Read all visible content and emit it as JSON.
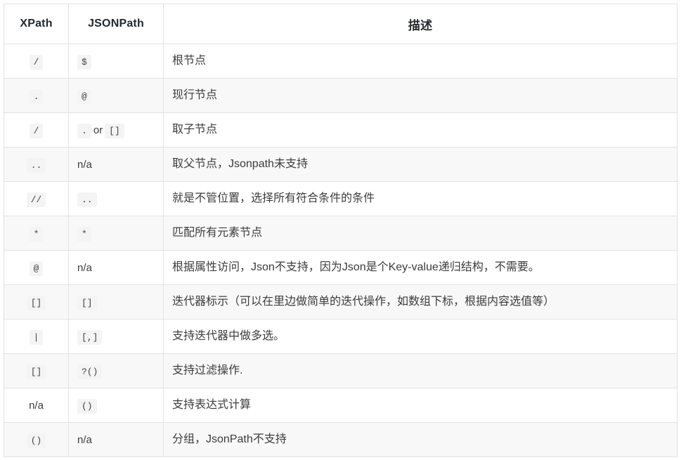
{
  "table": {
    "headers": {
      "xpath": "XPath",
      "jsonpath": "JSONPath",
      "description": "描述"
    },
    "rows": [
      {
        "xpath": [
          {
            "type": "code",
            "text": "/"
          }
        ],
        "jsonpath": [
          {
            "type": "code",
            "text": "$"
          }
        ],
        "description": "根节点"
      },
      {
        "xpath": [
          {
            "type": "code",
            "text": "."
          }
        ],
        "jsonpath": [
          {
            "type": "code",
            "text": "@"
          }
        ],
        "description": "现行节点"
      },
      {
        "xpath": [
          {
            "type": "code",
            "text": "/"
          }
        ],
        "jsonpath": [
          {
            "type": "code",
            "text": "."
          },
          {
            "type": "text",
            "text": "or"
          },
          {
            "type": "code",
            "text": "[]"
          }
        ],
        "description": "取子节点"
      },
      {
        "xpath": [
          {
            "type": "code",
            "text": ".."
          }
        ],
        "jsonpath": [
          {
            "type": "plain",
            "text": "n/a"
          }
        ],
        "description": "取父节点，Jsonpath未支持"
      },
      {
        "xpath": [
          {
            "type": "code",
            "text": "//"
          }
        ],
        "jsonpath": [
          {
            "type": "code",
            "text": ".."
          }
        ],
        "description": "就是不管位置，选择所有符合条件的条件"
      },
      {
        "xpath": [
          {
            "type": "code",
            "text": "*"
          }
        ],
        "jsonpath": [
          {
            "type": "code",
            "text": "*"
          }
        ],
        "description": "匹配所有元素节点"
      },
      {
        "xpath": [
          {
            "type": "code",
            "text": "@"
          }
        ],
        "jsonpath": [
          {
            "type": "plain",
            "text": "n/a"
          }
        ],
        "description": "根据属性访问，Json不支持，因为Json是个Key-value递归结构，不需要。"
      },
      {
        "xpath": [
          {
            "type": "code",
            "text": "[]"
          }
        ],
        "jsonpath": [
          {
            "type": "code",
            "text": "[]"
          }
        ],
        "description": "迭代器标示（可以在里边做简单的迭代操作，如数组下标，根据内容选值等）"
      },
      {
        "xpath": [
          {
            "type": "code",
            "text": "|"
          }
        ],
        "jsonpath": [
          {
            "type": "code",
            "text": "[,]"
          }
        ],
        "description": "支持迭代器中做多选。"
      },
      {
        "xpath": [
          {
            "type": "code",
            "text": "[]"
          }
        ],
        "jsonpath": [
          {
            "type": "code",
            "text": "?()"
          }
        ],
        "description": "支持过滤操作."
      },
      {
        "xpath": [
          {
            "type": "plain",
            "text": "n/a"
          }
        ],
        "jsonpath": [
          {
            "type": "code",
            "text": "()"
          }
        ],
        "description": "支持表达式计算"
      },
      {
        "xpath": [
          {
            "type": "code",
            "text": "()"
          }
        ],
        "jsonpath": [
          {
            "type": "plain",
            "text": "n/a"
          }
        ],
        "description": "分组，JsonPath不支持"
      }
    ]
  },
  "colors": {
    "border": "#e2e2e2",
    "alt_row_bg": "#f8f8f8",
    "code_bg": "#f4f4f4",
    "text": "#3c3c3c",
    "header_text": "#24292e"
  }
}
